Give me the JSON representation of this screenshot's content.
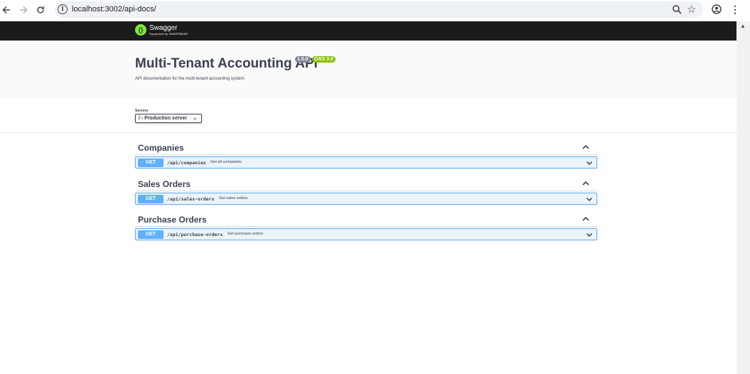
{
  "browser": {
    "url": "localhost:3002/api-docs/",
    "back_icon": "arrow-left-icon",
    "forward_icon": "arrow-right-icon",
    "reload_icon": "reload-icon"
  },
  "topbar": {
    "brand": "Swagger",
    "tagline": "Supported by SMARTBEAR"
  },
  "info": {
    "title": "Multi-Tenant Accounting API",
    "version": "1.0.0",
    "oas": "OAS 3.0",
    "description": "API documentation for the multi-tenant accounting system"
  },
  "servers": {
    "label": "Servers",
    "selected": "/ - Production server"
  },
  "tags": [
    {
      "name": "Companies",
      "op": {
        "method": "GET",
        "path": "/api/companies",
        "summary": "Get all companies"
      }
    },
    {
      "name": "Sales Orders",
      "op": {
        "method": "GET",
        "path": "/api/sales-orders",
        "summary": "Get sales orders"
      }
    },
    {
      "name": "Purchase Orders",
      "op": {
        "method": "GET",
        "path": "/api/purchase-orders",
        "summary": "Get purchase orders"
      }
    }
  ],
  "colors": {
    "get": "#61affe",
    "topbar": "#1b1b1b",
    "oas_badge": "#89bf04"
  }
}
